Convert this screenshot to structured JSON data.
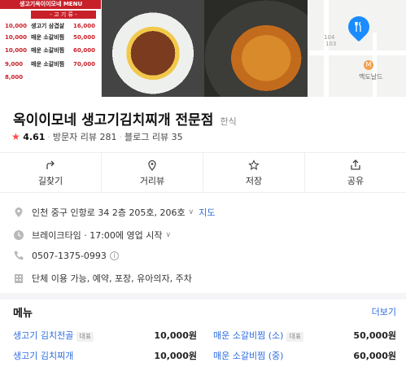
{
  "photos": {
    "menu_board": {
      "header": "생고기옥이이모네 MENU",
      "sub_header": "- 고 기 류 -",
      "rows": [
        {
          "left_price": "10,000",
          "item": "생고기 삼겹살",
          "right_price": "16,000"
        },
        {
          "left_price": "10,000",
          "item": "매운 소갈비찜",
          "right_price": "50,000"
        },
        {
          "left_price": "10,000",
          "item": "매운 소갈비찜",
          "right_price": "60,000"
        },
        {
          "left_price": "9,000",
          "item": "매운 소갈비찜",
          "right_price": "70,000"
        },
        {
          "left_price": "8,000",
          "item": "",
          "right_price": ""
        }
      ]
    },
    "map": {
      "labels": [
        "104",
        "103"
      ],
      "poi_label": "맥도날드",
      "pin_icon": "utensils-icon"
    }
  },
  "place": {
    "name": "옥이이모네 생고기김치찌개 전문점",
    "category": "한식",
    "rating": "4.61",
    "visitor_reviews": "방문자 리뷰 281",
    "blog_reviews": "블로그 리뷰 35"
  },
  "actions": [
    {
      "label": "길찾기",
      "icon": "directions-icon"
    },
    {
      "label": "거리뷰",
      "icon": "map-pin-icon"
    },
    {
      "label": "저장",
      "icon": "star-icon"
    },
    {
      "label": "공유",
      "icon": "share-icon"
    }
  ],
  "info": {
    "address": "인천 중구 인항로 34 2층 205호, 206호",
    "map_link": "지도",
    "hours": "브레이크타임 · 17:00에 영업 시작",
    "phone": "0507-1375-0993",
    "facilities": "단체 이용 가능, 예약, 포장, 유아의자, 주차"
  },
  "menu": {
    "title": "메뉴",
    "more": "더보기",
    "items": [
      {
        "name": "생고기 김치전골",
        "badge": "대표",
        "price": "10,000원"
      },
      {
        "name": "매운 소갈비찜 (소)",
        "badge": "대표",
        "price": "50,000원"
      },
      {
        "name": "생고기 김치찌개",
        "badge": "",
        "price": "10,000원"
      },
      {
        "name": "매운 소갈비찜 (중)",
        "badge": "",
        "price": "60,000원"
      }
    ]
  },
  "colors": {
    "accent": "#2d6ce0",
    "star": "#ff4b4b",
    "map_pin": "#1a8cff",
    "menu_board_red": "#c8202a"
  }
}
